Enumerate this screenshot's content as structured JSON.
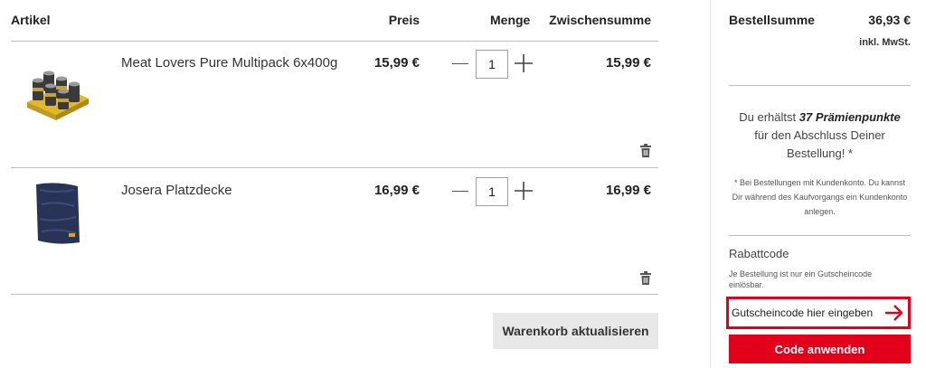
{
  "table": {
    "col_article": "Artikel",
    "col_price": "Preis",
    "col_qty": "Menge",
    "col_subtotal": "Zwischensumme"
  },
  "items": [
    {
      "name": "Meat Lovers Pure Multipack 6x400g",
      "price": "15,99 €",
      "qty": "1",
      "subtotal": "15,99 €",
      "image": "cans-multipack-image"
    },
    {
      "name": "Josera Platzdecke",
      "price": "16,99 €",
      "qty": "1",
      "subtotal": "16,99 €",
      "image": "dog-blanket-image"
    }
  ],
  "update_button": "Warenkorb aktualisieren",
  "summary": {
    "label": "Bestellsumme",
    "total": "36,93 €",
    "vat": "inkl. MwSt.",
    "points_prefix": "Du erhältst",
    "points_bold": "37 Prämienpunkte",
    "points_suffix": "für den Abschluss Deiner Bestellung! *",
    "note": "* Bei Bestellungen mit Kundenkonto. Du kannst Dir während des Kaufvorgangs ein Kundenkonto anlegen."
  },
  "coupon": {
    "title": "Rabattcode",
    "note": "Je Bestellung ist nur ein Gutscheincode einlösbar.",
    "placeholder": "Gutscheincode hier eingeben",
    "apply_button": "Code anwenden"
  },
  "colors": {
    "accent": "#e3001b",
    "button_grey": "#e8e8e8",
    "divider": "#bdbdbd"
  }
}
